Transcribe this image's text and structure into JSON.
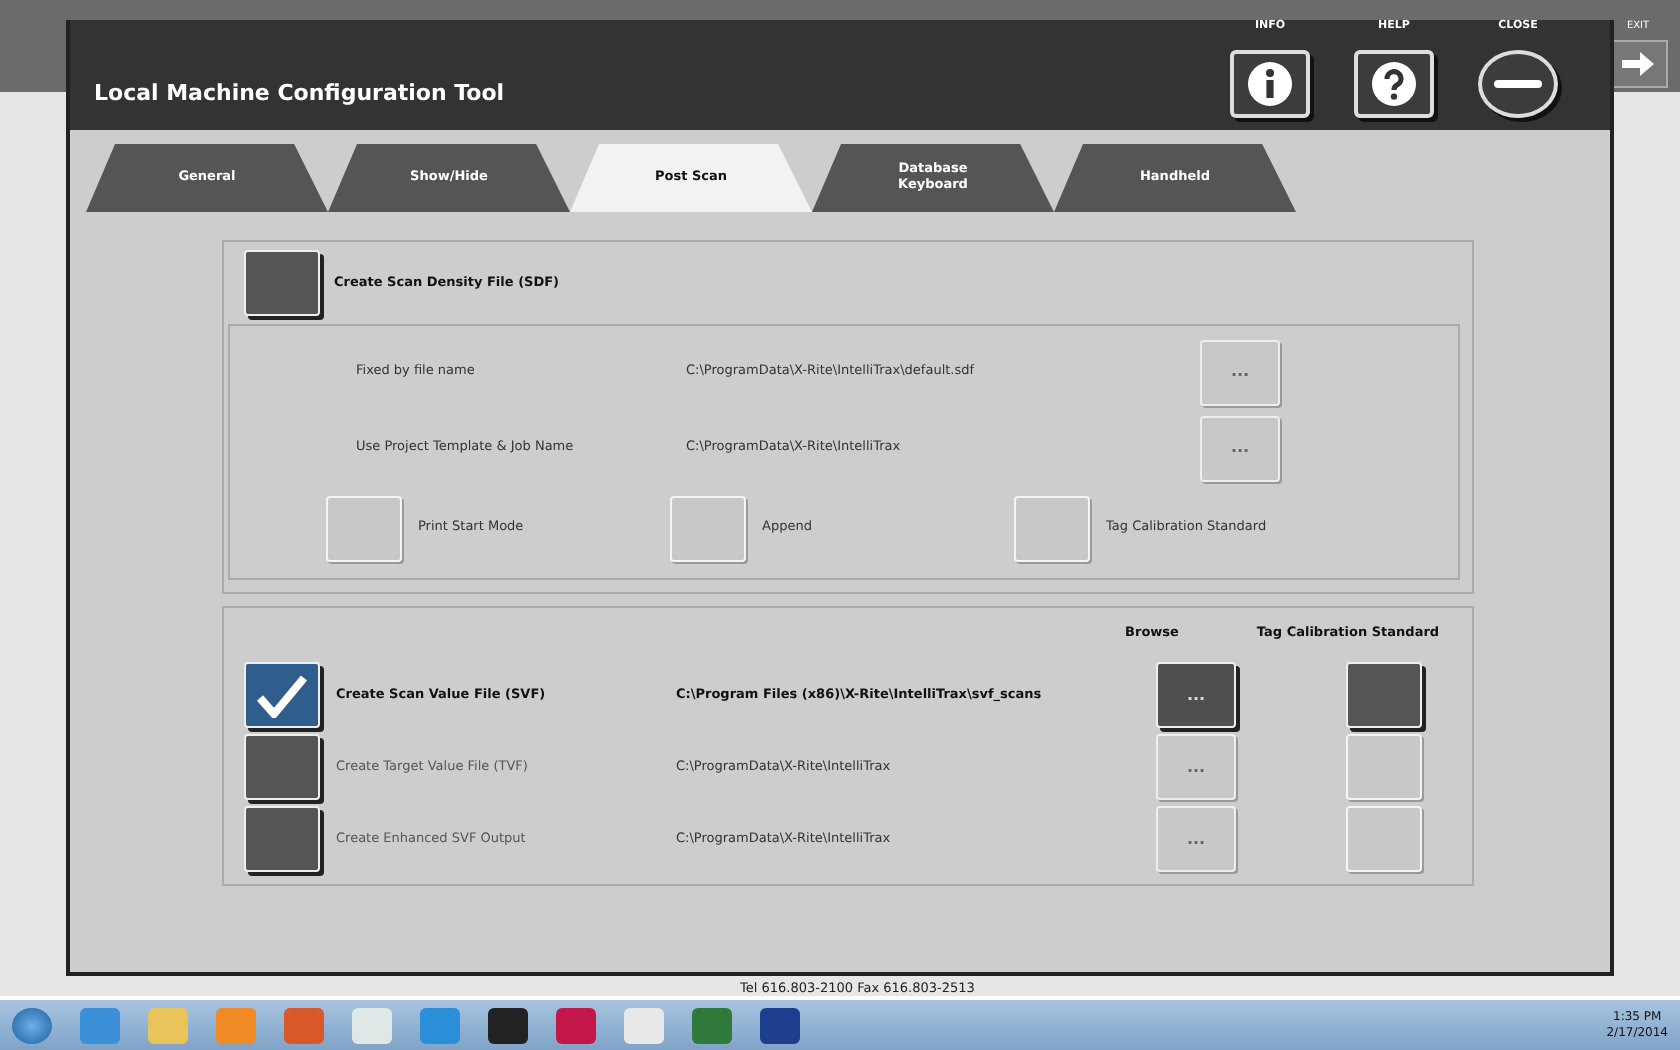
{
  "background_app": {
    "exit_label": "EXIT",
    "footer": "Tel 616.803-2100 Fax 616.803-2513"
  },
  "window": {
    "title": "Local Machine Configuration Tool"
  },
  "title_buttons": [
    {
      "kind": "info",
      "label": "INFO"
    },
    {
      "kind": "help",
      "label": "HELP"
    },
    {
      "kind": "close",
      "label": "CLOSE"
    }
  ],
  "tabs": [
    {
      "label": "General",
      "selected": false
    },
    {
      "label": "Show/Hide",
      "selected": false
    },
    {
      "label": "Post Scan",
      "selected": true
    },
    {
      "label": "Database Keyboard",
      "selected": false
    },
    {
      "label": "Handheld",
      "selected": false
    }
  ],
  "sdf": {
    "label": "Create Scan Density File (SDF)",
    "checked": false,
    "options": [
      {
        "label": "Fixed by file name",
        "path": "C:\\ProgramData\\X-Rite\\IntelliTrax\\default.sdf",
        "button": "...",
        "disabled": true
      },
      {
        "label": "Use Project Template & Job Name",
        "path": "C:\\ProgramData\\X-Rite\\IntelliTrax",
        "button": "...",
        "disabled": true
      }
    ],
    "modes": [
      {
        "label": "Print Start Mode",
        "checked": false,
        "disabled": true
      },
      {
        "label": "Append",
        "checked": false,
        "disabled": true
      },
      {
        "label": "Tag Calibration Standard",
        "checked": false,
        "disabled": true
      }
    ]
  },
  "outputs": {
    "columns": [
      "Browse",
      "Tag Calibration Standard"
    ],
    "rows": [
      {
        "label": "Create Scan Value File (SVF)",
        "path": "C:\\Program Files (x86)\\X-Rite\\IntelliTrax\\svf_scans",
        "checked": true,
        "browse": "...",
        "tag_checked": false
      },
      {
        "label": "Create Target Value File (TVF)",
        "path": "C:\\ProgramData\\X-Rite\\IntelliTrax",
        "checked": false,
        "browse": "...",
        "tag_checked": false
      },
      {
        "label": "Create Enhanced SVF Output",
        "path": "C:\\ProgramData\\X-Rite\\IntelliTrax",
        "checked": false,
        "browse": "...",
        "tag_checked": false
      }
    ]
  },
  "taskbar": {
    "time": "1:35 PM",
    "date": "2/17/2014"
  }
}
